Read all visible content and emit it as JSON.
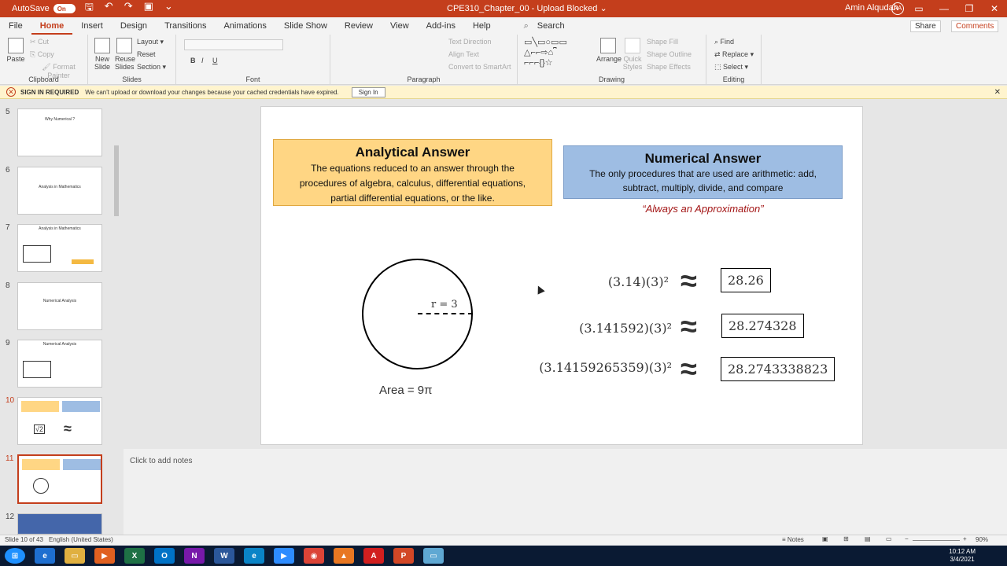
{
  "titlebar": {
    "autosave": "AutoSave",
    "autosave_state": "On",
    "document": "CPE310_Chapter_00  -  Upload Blocked  ⌄",
    "user": "Amin Alqudah",
    "initials": "AA"
  },
  "menubar": {
    "tabs": [
      "File",
      "Home",
      "Insert",
      "Design",
      "Transitions",
      "Animations",
      "Slide Show",
      "Review",
      "View",
      "Add-ins",
      "Help"
    ],
    "search": "Search",
    "share": "Share",
    "comments": "Comments"
  },
  "ribbon": {
    "clipboard": {
      "label": "Clipboard",
      "paste": "Paste",
      "cut": "Cut",
      "copy": "Copy",
      "format_painter": "Format Painter"
    },
    "slides": {
      "label": "Slides",
      "new_slide": "New Slide",
      "reuse_slides": "Reuse Slides",
      "layout": "Layout",
      "reset": "Reset",
      "section": "Section"
    },
    "font": {
      "label": "Font"
    },
    "paragraph": {
      "label": "Paragraph",
      "text_direction": "Text Direction",
      "align_text": "Align Text",
      "convert_smartart": "Convert to SmartArt"
    },
    "drawing": {
      "label": "Drawing",
      "arrange": "Arrange",
      "quick_styles": "Quick Styles",
      "shape_fill": "Shape Fill",
      "shape_outline": "Shape Outline",
      "shape_effects": "Shape Effects"
    },
    "editing": {
      "label": "Editing",
      "find": "Find",
      "replace": "Replace",
      "select": "Select"
    }
  },
  "signbar": {
    "title": "SIGN IN REQUIRED",
    "message": "We can't upload or download your changes because your cached credentials have expired.",
    "button": "Sign In"
  },
  "thumbnails": [
    {
      "num": "5",
      "title": "Why Numerical ?"
    },
    {
      "num": "6",
      "title": "Analysis in Mathematics"
    },
    {
      "num": "7",
      "title": "Analysis in Mathematics"
    },
    {
      "num": "8",
      "title": "Numerical Analysis"
    },
    {
      "num": "9",
      "title": "Numerical Analysis"
    },
    {
      "num": "10",
      "title": ""
    },
    {
      "num": "11",
      "title": ""
    },
    {
      "num": "12",
      "title": ""
    }
  ],
  "slide": {
    "analytical": {
      "heading": "Analytical Answer",
      "line1": "The equations reduced to an answer through the",
      "line2": "procedures of algebra, calculus, differential equations,",
      "line3": "partial differential equations, or the like."
    },
    "numerical": {
      "heading": "Numerical Answer",
      "line1": "The only procedures that are used are arithmetic: add,",
      "line2": "subtract, multiply, divide, and compare"
    },
    "approx_note": "“Always an Approximation”",
    "radius_label": "r = 3",
    "area_label": "Area = 9π",
    "equations": [
      {
        "expr": "(3.14)(3)²",
        "result": "28.26"
      },
      {
        "expr": "(3.141592)(3)²",
        "result": "28.274328"
      },
      {
        "expr": "(3.14159265359)(3)²",
        "result": "28.2743338823"
      }
    ],
    "approx_symbol": "≈"
  },
  "notes": {
    "placeholder": "Click to add notes"
  },
  "status": {
    "slide": "Slide 10 of 43",
    "language": "English (United States)",
    "notes": "Notes",
    "zoom": "90%"
  },
  "taskbar": {
    "time": "10:12 AM",
    "date": "3/4/2021"
  }
}
